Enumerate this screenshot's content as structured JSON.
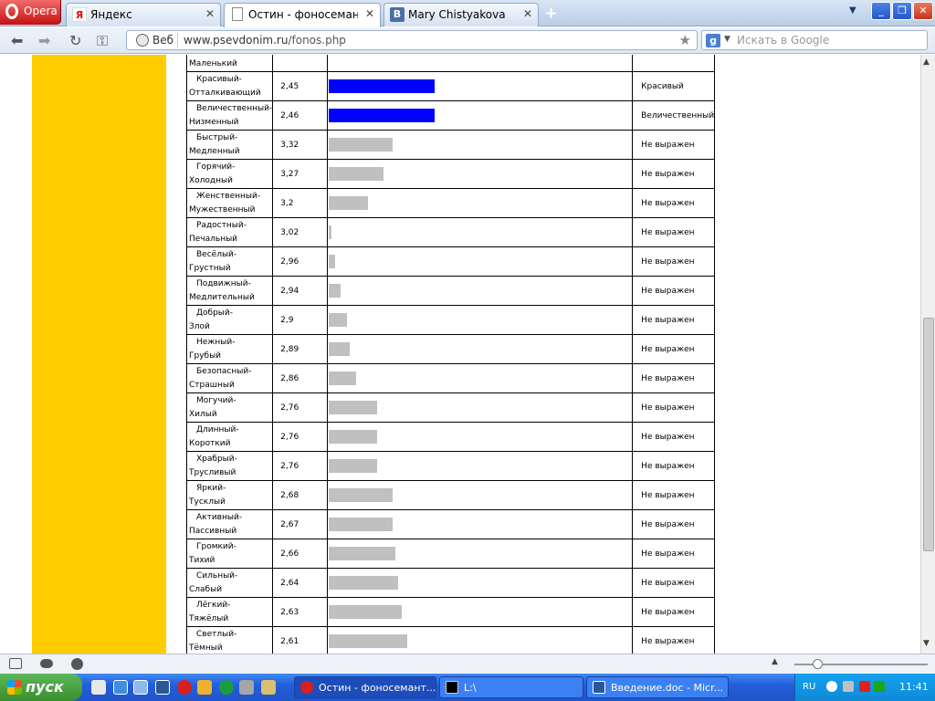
{
  "browser": {
    "menu_label": "Opera",
    "tabs": [
      {
        "label": "Яндекс",
        "icon": "yandex-icon",
        "active": false
      },
      {
        "label": "Остин - фоносемантиче...",
        "icon": "page-icon",
        "active": true
      },
      {
        "label": "Mary Chistyakova",
        "icon": "vk-icon",
        "active": false
      }
    ],
    "web_label": "Веб",
    "url_host": "www.psevdonim.ru",
    "url_path": "/fonos.php",
    "search_placeholder": "Искать в Google"
  },
  "colors": {
    "sidebar": "#ffcc00",
    "bar": "#c0c0c0",
    "bar_highlight": "#0000ff"
  },
  "table": {
    "partial_top_label": "Маленький",
    "rows": [
      {
        "line1": "Красивый-",
        "line2": "Отталкивающий",
        "value": "2,45",
        "bar_fraction": 0.35,
        "highlight": true,
        "result": "Красивый"
      },
      {
        "line1": "Величественный-",
        "line2": "Низменный",
        "value": "2,46",
        "bar_fraction": 0.35,
        "highlight": true,
        "result": "Величественный"
      },
      {
        "line1": "Быстрый-",
        "line2": "Медленный",
        "value": "3,32",
        "bar_fraction": 0.21,
        "highlight": false,
        "result": "Не выражен"
      },
      {
        "line1": "Горячий-",
        "line2": "Холодный",
        "value": "3,27",
        "bar_fraction": 0.18,
        "highlight": false,
        "result": "Не выражен"
      },
      {
        "line1": "Женственный-",
        "line2": "Мужественный",
        "value": "3,2",
        "bar_fraction": 0.13,
        "highlight": false,
        "result": "Не выражен"
      },
      {
        "line1": "Радостный-",
        "line2": "Печальный",
        "value": "3,02",
        "bar_fraction": 0.01,
        "highlight": false,
        "result": "Не выражен"
      },
      {
        "line1": "Весёлый-",
        "line2": "Грустный",
        "value": "2,96",
        "bar_fraction": 0.02,
        "highlight": false,
        "result": "Не выражен"
      },
      {
        "line1": "Подвижный-",
        "line2": "Медлительный",
        "value": "2,94",
        "bar_fraction": 0.04,
        "highlight": false,
        "result": "Не выражен"
      },
      {
        "line1": "Добрый-",
        "line2": "Злой",
        "value": "2,9",
        "bar_fraction": 0.06,
        "highlight": false,
        "result": "Не выражен"
      },
      {
        "line1": "Нежный-",
        "line2": "Грубый",
        "value": "2,89",
        "bar_fraction": 0.07,
        "highlight": false,
        "result": "Не выражен"
      },
      {
        "line1": "Безопасный-",
        "line2": "Страшный",
        "value": "2,86",
        "bar_fraction": 0.09,
        "highlight": false,
        "result": "Не выражен"
      },
      {
        "line1": "Могучий-",
        "line2": "Хилый",
        "value": "2,76",
        "bar_fraction": 0.16,
        "highlight": false,
        "result": "Не выражен"
      },
      {
        "line1": "Длинный-",
        "line2": "Короткий",
        "value": "2,76",
        "bar_fraction": 0.16,
        "highlight": false,
        "result": "Не выражен"
      },
      {
        "line1": "Храбрый-",
        "line2": "Трусливый",
        "value": "2,76",
        "bar_fraction": 0.16,
        "highlight": false,
        "result": "Не выражен"
      },
      {
        "line1": "Яркий-",
        "line2": "Тусклый",
        "value": "2,68",
        "bar_fraction": 0.21,
        "highlight": false,
        "result": "Не выражен"
      },
      {
        "line1": "Активный-",
        "line2": "Пассивный",
        "value": "2,67",
        "bar_fraction": 0.21,
        "highlight": false,
        "result": "Не выражен"
      },
      {
        "line1": "Громкий-",
        "line2": "Тихий",
        "value": "2,66",
        "bar_fraction": 0.22,
        "highlight": false,
        "result": "Не выражен"
      },
      {
        "line1": "Сильный-",
        "line2": "Слабый",
        "value": "2,64",
        "bar_fraction": 0.23,
        "highlight": false,
        "result": "Не выражен"
      },
      {
        "line1": "Лёгкий-",
        "line2": "Тяжёлый",
        "value": "2,63",
        "bar_fraction": 0.24,
        "highlight": false,
        "result": "Не выражен"
      },
      {
        "line1": "Светлый-",
        "line2": "Тёмный",
        "value": "2,61",
        "bar_fraction": 0.26,
        "highlight": false,
        "result": "Не выражен"
      }
    ]
  },
  "taskbar": {
    "start_label": "пуск",
    "tasks": [
      {
        "label": "Остин - фоносемант...",
        "icon": "opera-icon",
        "active": true
      },
      {
        "label": "L:\\",
        "icon": "console-icon",
        "active": false
      },
      {
        "label": "Введение.doc - Micr...",
        "icon": "word-icon",
        "active": false
      }
    ],
    "lang": "RU",
    "clock": "11:41"
  }
}
